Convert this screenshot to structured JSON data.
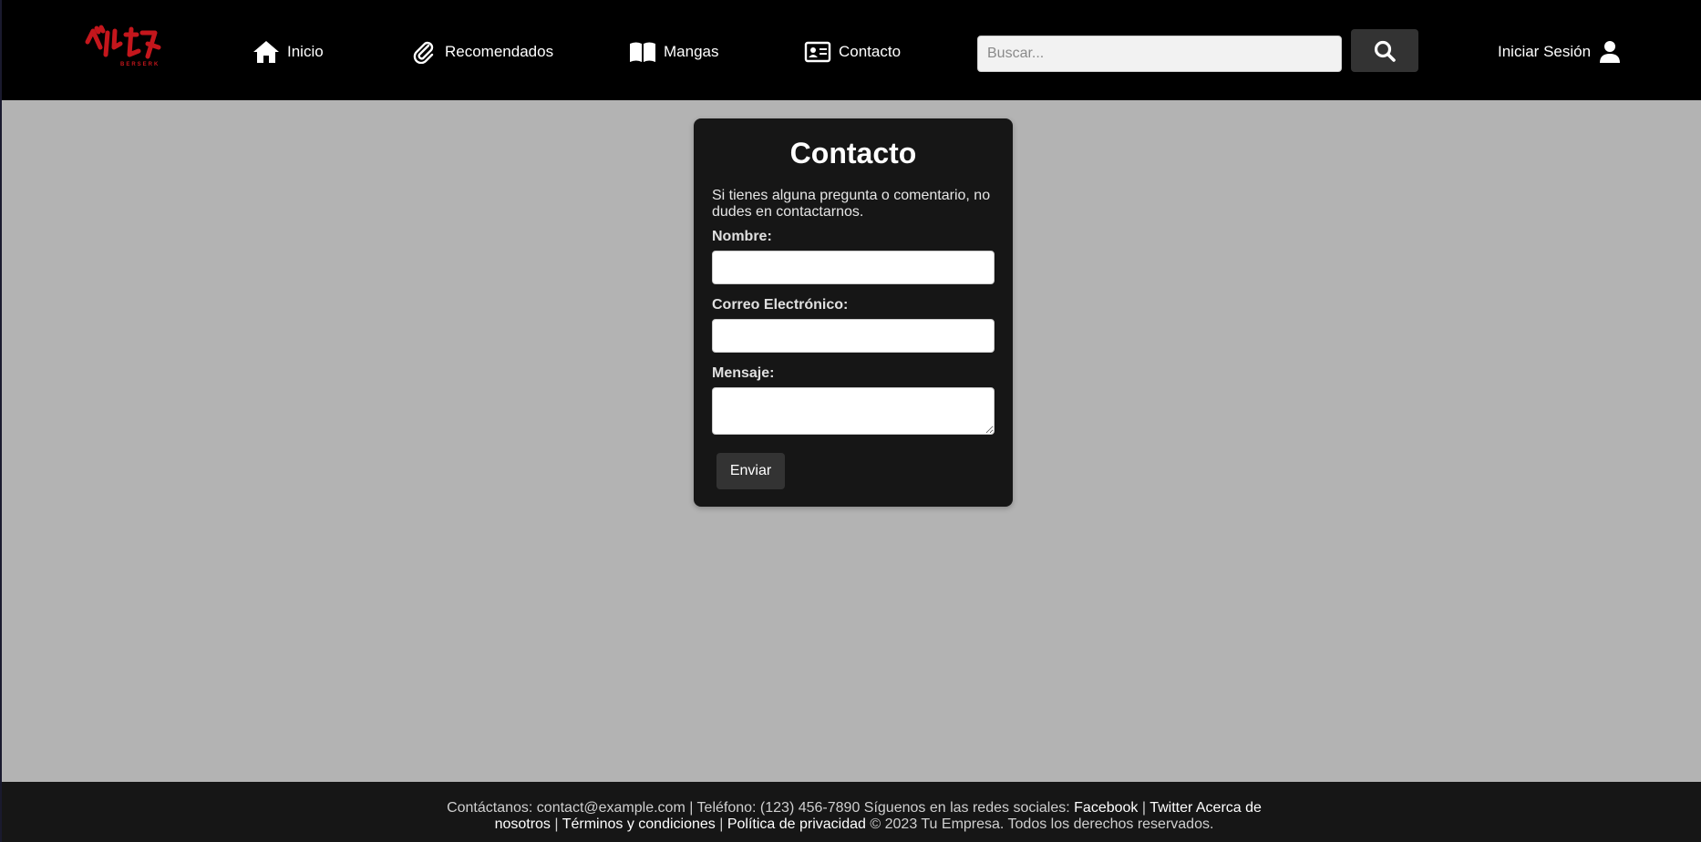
{
  "header": {
    "logo_alt": "ベルセルク",
    "nav": [
      {
        "label": "Inicio",
        "icon": "home-icon"
      },
      {
        "label": "Recomendados",
        "icon": "paperclip-icon"
      },
      {
        "label": "Mangas",
        "icon": "open-book-icon"
      },
      {
        "label": "Contacto",
        "icon": "id-card-icon"
      }
    ],
    "search": {
      "placeholder": "Buscar...",
      "value": "",
      "button_icon": "search-icon"
    },
    "login": {
      "label": "Iniciar Sesión",
      "icon": "user-icon"
    }
  },
  "contact_form": {
    "title": "Contacto",
    "description": "Si tienes alguna pregunta o comentario, no dudes en contactarnos.",
    "fields": [
      {
        "label": "Nombre:",
        "value": ""
      },
      {
        "label": "Correo Electrónico:",
        "value": ""
      },
      {
        "label": "Mensaje:",
        "value": ""
      }
    ],
    "submit_label": "Enviar"
  },
  "footer": {
    "contact_prefix": "Contáctanos: contact@example.com | Teléfono: (123) 456-7890 Síguenos en las redes sociales:",
    "links": {
      "facebook": "Facebook",
      "twitter": "Twitter",
      "about": "Acerca de nosotros",
      "terms": "Términos y condiciones",
      "privacy": "Política de privacidad"
    },
    "separator": "|",
    "copyright": "© 2023 Tu Empresa. Todos los derechos reservados."
  },
  "colors": {
    "header_bg": "#000000",
    "page_bg": "#b3b3b3",
    "card_bg": "#161616",
    "button_bg": "#333333",
    "logo_red": "#c4161c"
  }
}
